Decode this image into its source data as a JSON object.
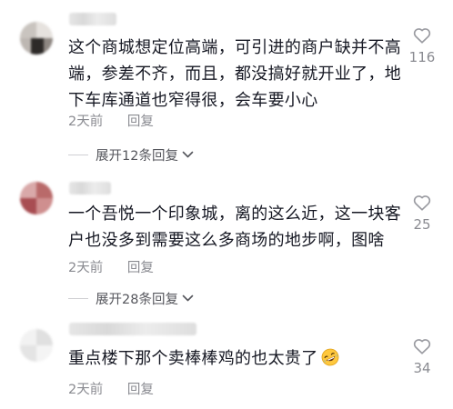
{
  "comments": [
    {
      "text": "这个商城想定位高端，可引进的商户缺并不高端，参差不齐，而且，都没搞好就开业了，地下车库通道也窄得很，会车要小心",
      "time": "2天前",
      "reply_label": "回复",
      "likes": "116",
      "expand_label": "展开12条回复"
    },
    {
      "text": "一个吾悦一个印象城，离的这么近，这一块客户也没多到需要这么多商场的地步啊，图啥",
      "time": "2天前",
      "reply_label": "回复",
      "likes": "25",
      "expand_label": "展开28条回复"
    },
    {
      "text": "重点楼下那个卖棒棒鸡的也太贵了",
      "emoji": "rofl-emoji",
      "time": "2天前",
      "reply_label": "回复",
      "likes": "34"
    }
  ],
  "colors": {
    "text": "#161823",
    "meta": "#8a8b91",
    "expand": "#55565c",
    "heart_outline": "#9a9ba1"
  },
  "icons": {
    "like": "heart-outline-icon",
    "expand": "chevron-down-icon"
  }
}
